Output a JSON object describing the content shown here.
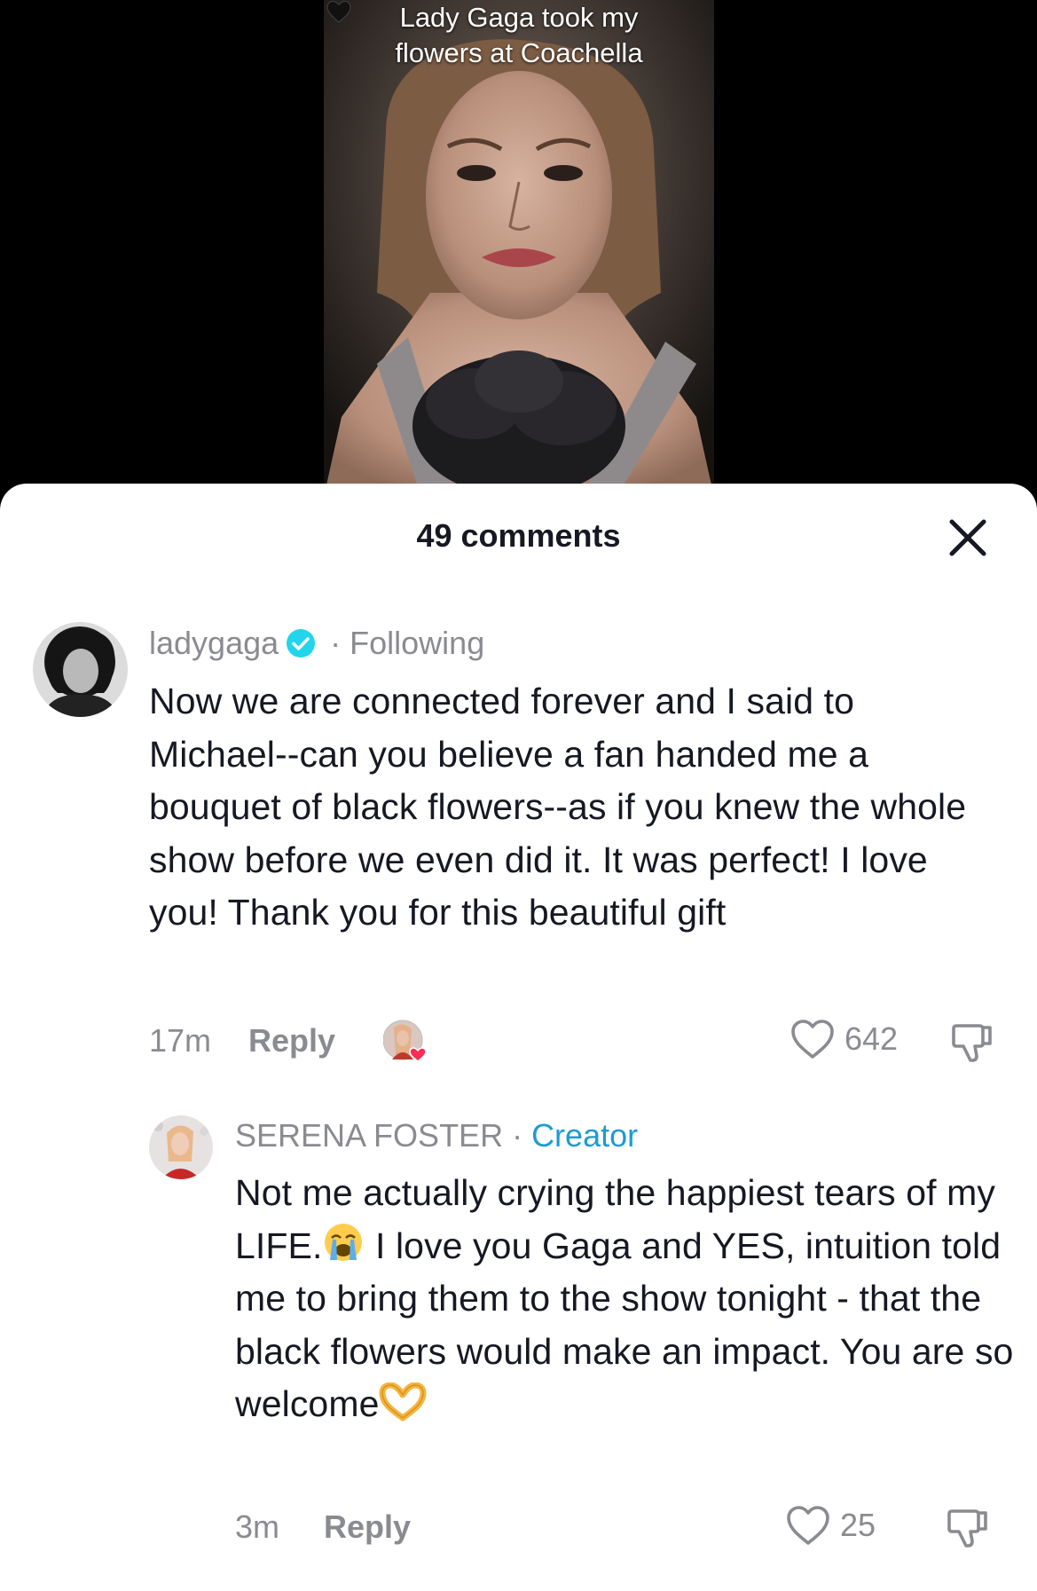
{
  "video": {
    "caption_line1": "Lady Gaga took my",
    "caption_line2": "flowers at Coachella",
    "caption_emoji": "black-heart-icon"
  },
  "comments_sheet": {
    "title": "49 comments",
    "close_icon": "close-icon"
  },
  "comments": [
    {
      "author": "ladygaga",
      "verified": true,
      "relation": "Following",
      "text": "Now we are connected forever and I said to Michael--can you believe a fan handed me a bouquet of black flowers--as if you knew the whole show before we even did it. It was perfect! I love you! Thank you for this beautiful gift",
      "time": "17m",
      "reply_label": "Reply",
      "liked_by_creator": true,
      "likes": "642"
    },
    {
      "author": "SERENA FOSTER",
      "tag": "Creator",
      "text_part1": "Not me actually crying the happiest tears of my LIFE.",
      "text_emoji1": "loudly-crying-face-icon",
      "text_part2": " I love you Gaga and YES, intuition told me to bring them to the show tonight - that the black flowers would make an impact. You are so welcome",
      "text_emoji2": "heart-hands-icon",
      "time": "3m",
      "reply_label": "Reply",
      "likes": "25"
    }
  ],
  "colors": {
    "text_primary": "#161823",
    "text_secondary": "#8a8b91",
    "verified_blue": "#20d5ec",
    "creator_blue": "#1c9ccf",
    "liked_heart": "#fe2c55"
  }
}
